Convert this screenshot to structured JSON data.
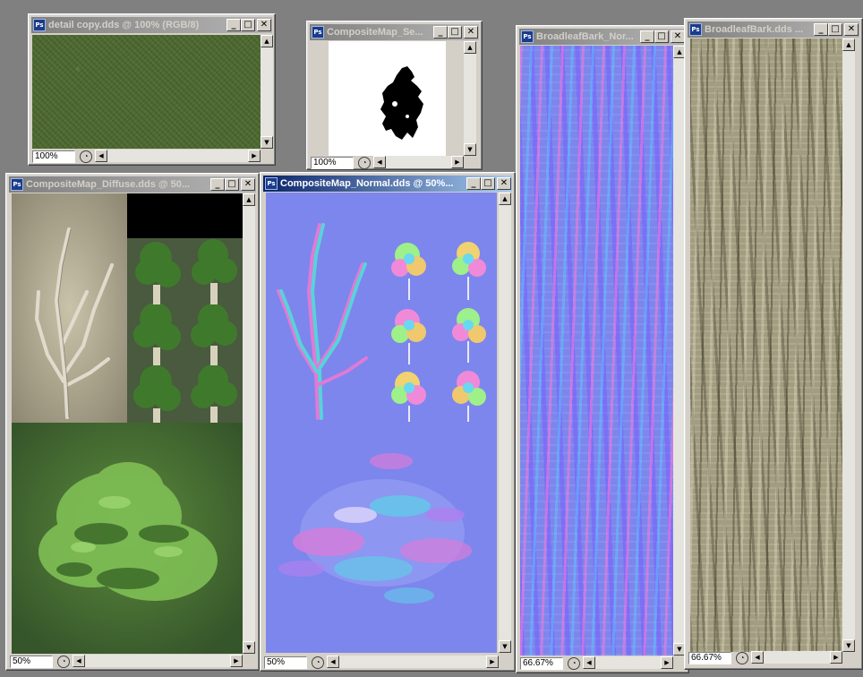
{
  "windows": {
    "detail": {
      "title": "detail copy.dds @ 100% (RGB/8)",
      "zoom": "100%"
    },
    "selection": {
      "title": "CompositeMap_Se...",
      "zoom": "100%"
    },
    "diffuse": {
      "title": "CompositeMap_Diffuse.dds @ 50...",
      "zoom": "50%"
    },
    "normal": {
      "title": "CompositeMap_Normal.dds @ 50%...",
      "zoom": "50%"
    },
    "bark_normal": {
      "title": "BroadleafBark_Nor...",
      "zoom": "66.67%"
    },
    "bark": {
      "title": "BroadleafBark.dds ...",
      "zoom": "66.67%"
    }
  },
  "app_icon": "Ps",
  "icons": {
    "minimize": "minimize-icon",
    "maximize": "maximize-icon",
    "close": "close-icon",
    "navigator": "navigator-icon"
  },
  "colors": {
    "active_titlebar": "#0a246a",
    "inactive_titlebar": "#808080",
    "window_face": "#d4d0c8",
    "normal_map_base": "#7d86ec"
  }
}
